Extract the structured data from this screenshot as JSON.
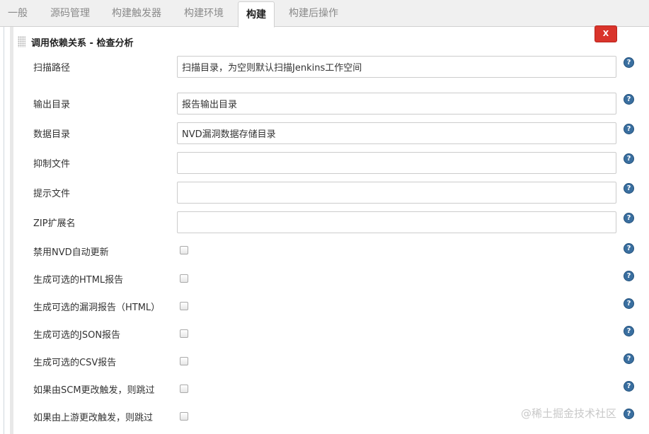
{
  "tabs": [
    {
      "label": "一般"
    },
    {
      "label": "源码管理"
    },
    {
      "label": "构建触发器"
    },
    {
      "label": "构建环境"
    },
    {
      "label": "构建",
      "active": true
    },
    {
      "label": "构建后操作"
    }
  ],
  "section": {
    "title": "调用依赖关系 - 检查分析",
    "delete_label": "X"
  },
  "fields": [
    {
      "label": "扫描路径",
      "value": "扫描目录，为空则默认扫描Jenkins工作空间"
    },
    {
      "label": "输出目录",
      "value": "报告输出目录"
    },
    {
      "label": "数据目录",
      "value": "NVD漏洞数据存储目录"
    },
    {
      "label": "抑制文件",
      "value": ""
    },
    {
      "label": "提示文件",
      "value": ""
    },
    {
      "label": "ZIP扩展名",
      "value": ""
    }
  ],
  "checkboxes": [
    {
      "label": "禁用NVD自动更新",
      "checked": false
    },
    {
      "label": "生成可选的HTML报告",
      "checked": false
    },
    {
      "label": "生成可选的漏洞报告（HTML）",
      "checked": false
    },
    {
      "label": "生成可选的JSON报告",
      "checked": false
    },
    {
      "label": "生成可选的CSV报告",
      "checked": false
    },
    {
      "label": "如果由SCM更改触发，则跳过",
      "checked": false
    },
    {
      "label": "如果由上游更改触发，则跳过",
      "checked": false
    }
  ],
  "help_glyph": "?",
  "watermark": "@稀土掘金技术社区",
  "colors": {
    "delete_button": "#d9342b",
    "help_icon": "#3a6fa0",
    "tab_bar": "#f0f0f0"
  }
}
